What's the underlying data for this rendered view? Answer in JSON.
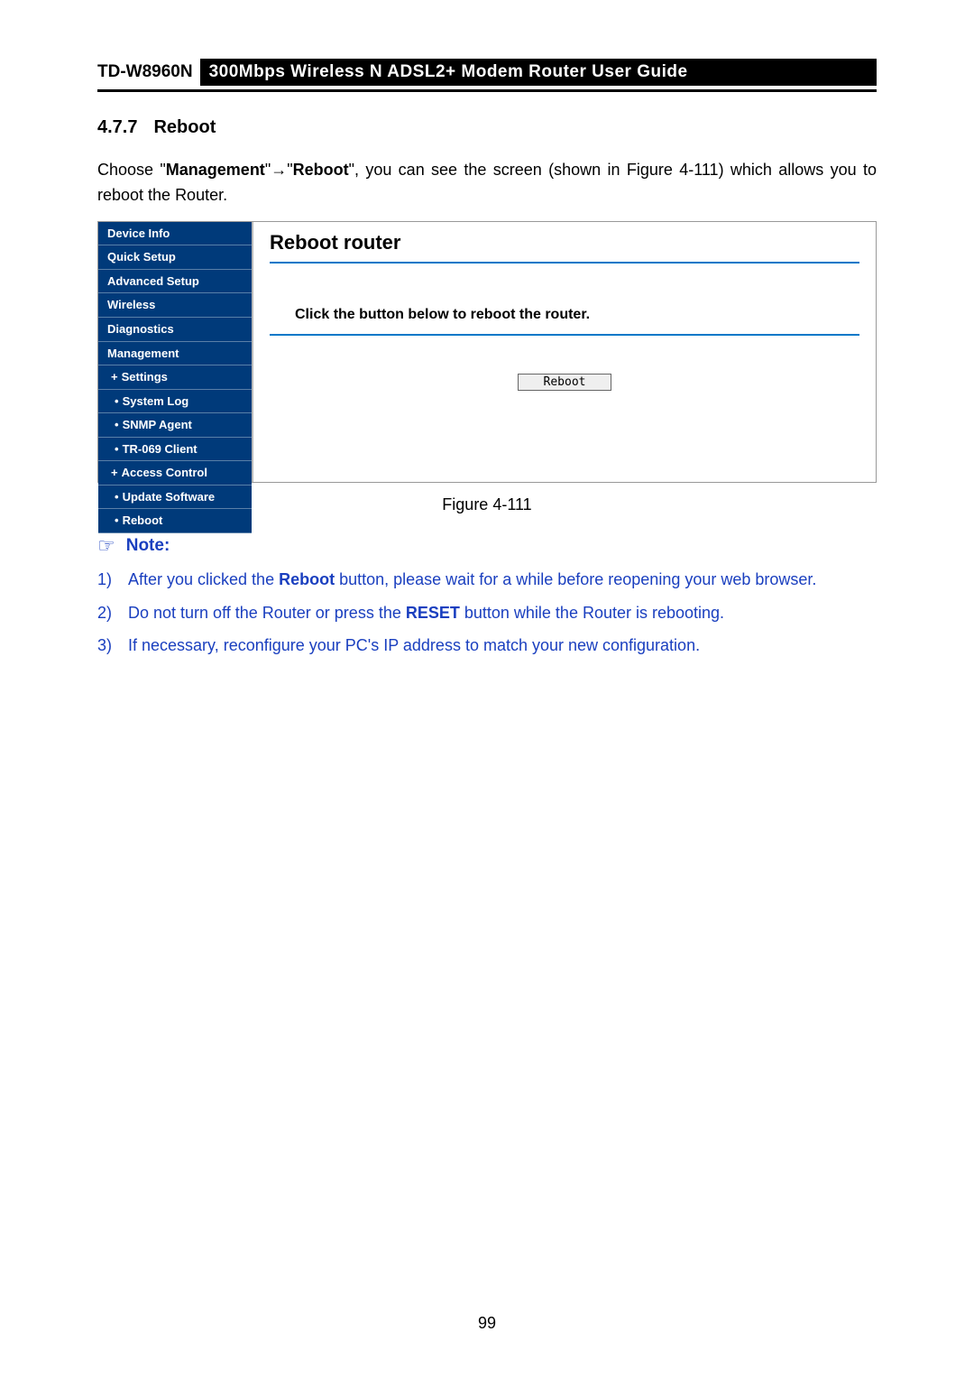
{
  "header": {
    "model": "TD-W8960N",
    "title": "300Mbps  Wireless  N  ADSL2+  Modem  Router  User  Guide"
  },
  "section": {
    "number": "4.7.7",
    "title": "Reboot"
  },
  "intro": {
    "pre": "Choose \"",
    "m1": "Management",
    "mid": "\"→\"",
    "m2": "Reboot",
    "post": "\", you can see the screen (shown in Figure 4-111) which allows you to reboot the Router."
  },
  "sidebar": {
    "items": [
      {
        "label": "Device Info",
        "type": "top"
      },
      {
        "label": "Quick Setup",
        "type": "top"
      },
      {
        "label": "Advanced Setup",
        "type": "top"
      },
      {
        "label": "Wireless",
        "type": "top"
      },
      {
        "label": "Diagnostics",
        "type": "top"
      },
      {
        "label": "Management",
        "type": "top"
      },
      {
        "label": "Settings",
        "type": "expand"
      },
      {
        "label": "System Log",
        "type": "sub"
      },
      {
        "label": "SNMP Agent",
        "type": "sub"
      },
      {
        "label": "TR-069 Client",
        "type": "sub"
      },
      {
        "label": "Access Control",
        "type": "expand"
      },
      {
        "label": "Update Software",
        "type": "sub"
      },
      {
        "label": "Reboot",
        "type": "sub"
      }
    ]
  },
  "panel": {
    "title": "Reboot router",
    "text": "Click the button below to reboot the router.",
    "button": "Reboot"
  },
  "figure_caption": "Figure 4-111",
  "note": {
    "heading": "Note:",
    "items": [
      {
        "num": "1)",
        "pre": "After  you  clicked  the  ",
        "b1": "Reboot",
        "post": "  button,  please  wait  for  a  while  before  reopening  your  web browser."
      },
      {
        "num": "2)",
        "pre": "Do not turn off the Router or press the ",
        "b1": "RESET",
        "post": " button while the Router is rebooting."
      },
      {
        "num": "3)",
        "pre": "If necessary, reconfigure your PC's IP address to match your new configuration.",
        "b1": "",
        "post": ""
      }
    ]
  },
  "page_number": "99"
}
